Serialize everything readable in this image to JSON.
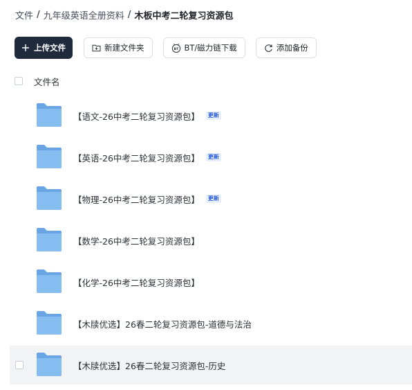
{
  "breadcrumb": {
    "items": [
      "文件",
      "九年级英语全册资料",
      "木板中考二轮复习资源包"
    ],
    "separator": "/"
  },
  "toolbar": {
    "upload_label": "上传文件",
    "new_folder_label": "新建文件夹",
    "bt_label": "BT/磁力链下载",
    "backup_label": "添加备份"
  },
  "list": {
    "column_name": "文件名",
    "badge_label": "更新",
    "rows": [
      {
        "name": "【语文-26中考二轮复习资源包】",
        "badge": "更新"
      },
      {
        "name": "【英语-26中考二轮复习资源包】",
        "badge": "更新"
      },
      {
        "name": "【物理-26中考二轮复习资源包】",
        "badge": "更新"
      },
      {
        "name": "【数学-26中考二轮复习资源包】"
      },
      {
        "name": "【化学-26中考二轮复习资源包】"
      },
      {
        "name": "【木牍优选】26春二轮复习资源包-道德与法治"
      },
      {
        "name": "【木牍优选】26春二轮复习资源包-历史"
      }
    ]
  },
  "colors": {
    "primary_button": "#1f2a3d",
    "folder": "#7fb7ee",
    "badge_bg": "#e6efff",
    "badge_text": "#2a5bd7",
    "row_hover": "#f2f3f5"
  },
  "icons": {
    "upload": "plus-icon",
    "new_folder": "folder-plus-icon",
    "bt": "bt-icon",
    "backup": "sync-icon",
    "folder": "folder-icon"
  }
}
